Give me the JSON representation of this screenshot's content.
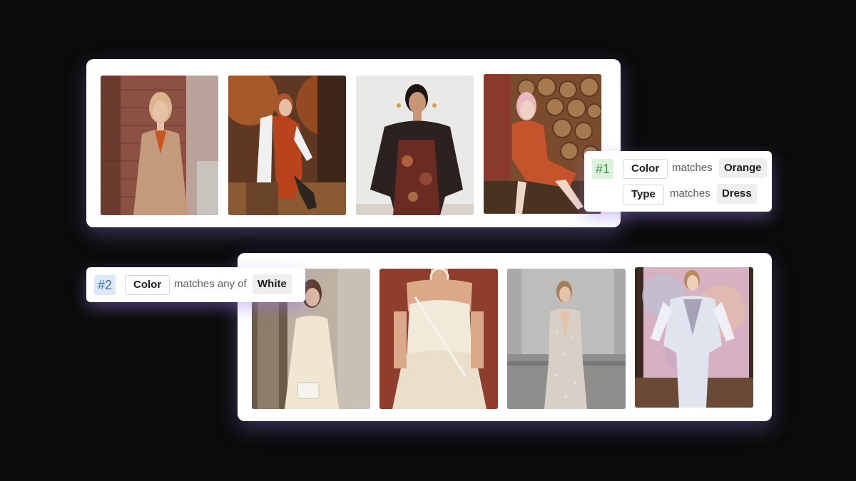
{
  "rules": [
    {
      "number": "#1",
      "conditions": [
        {
          "field": "Color",
          "operator": "matches",
          "value": "Orange"
        },
        {
          "field": "Type",
          "operator": "matches",
          "value": "Dress"
        }
      ]
    },
    {
      "number": "#2",
      "conditions": [
        {
          "field": "Color",
          "operator": "matches any of",
          "value": "White"
        }
      ]
    }
  ],
  "colors": {
    "background": "#0b0b0b",
    "panel": "#ffffff",
    "glow": "#9678e6",
    "badge_green_bg": "#dff2dc",
    "badge_green_text": "#3d9a45",
    "badge_blue_bg": "#dde8f7",
    "badge_blue_text": "#3a6fb5"
  }
}
